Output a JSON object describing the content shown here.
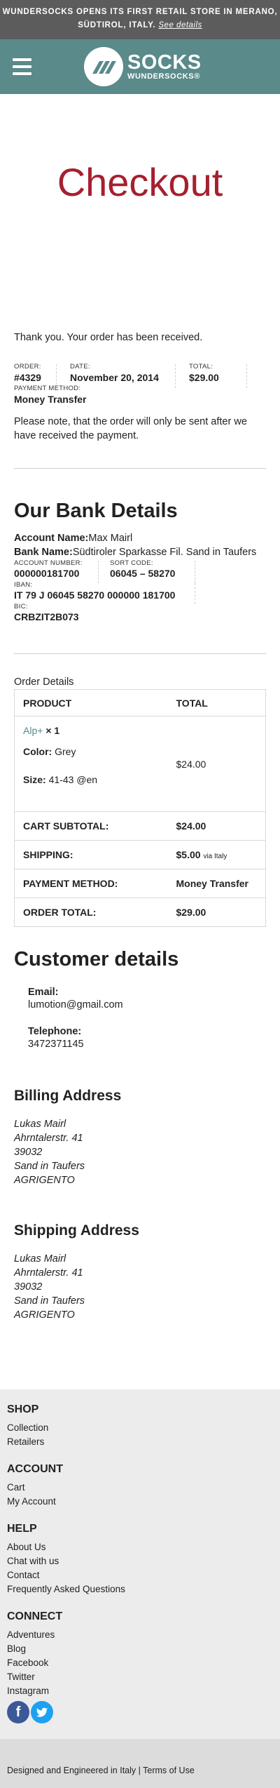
{
  "banner": {
    "text": "WUNDERSOCKS OPENS ITS FIRST RETAIL STORE IN MERANO, SÜDTIROL, ITALY.",
    "link": "See details"
  },
  "header": {
    "logo_big": "SOCKS",
    "logo_small": "WUNDERSOCKS®"
  },
  "page_title": "Checkout",
  "thanks": "Thank you. Your order has been received.",
  "order": {
    "order_label": "ORDER:",
    "order_value": "#4329",
    "date_label": "DATE:",
    "date_value": "November 20, 2014",
    "total_label": "TOTAL:",
    "total_value": "$29.00",
    "pm_label": "PAYMENT METHOD:",
    "pm_value": "Money Transfer"
  },
  "note": "Please note, that the order will only be sent after we have received the payment.",
  "bank": {
    "title": "Our Bank Details",
    "account_name_label": "Account Name:",
    "account_name": "Max Mairl",
    "bank_name_label": "Bank Name:",
    "bank_name": "Südtiroler Sparkasse Fil. Sand in Taufers",
    "account_number_label": "ACCOUNT NUMBER:",
    "account_number": "000000181700",
    "sort_code_label": "SORT CODE:",
    "sort_code": "06045 – 58270",
    "iban_label": "IBAN:",
    "iban": "IT 79 J 06045 58270 000000 181700",
    "bic_label": "BIC:",
    "bic": "CRBZIT2B073"
  },
  "order_details": {
    "title": "Order Details",
    "col_product": "PRODUCT",
    "col_total": "TOTAL",
    "product_name": "Alp+",
    "product_qty": "× 1",
    "color_label": "Color:",
    "color_value": "Grey",
    "size_label": "Size:",
    "size_value": "41-43 @en",
    "product_price": "$24.00",
    "subtotal_label": "CART SUBTOTAL:",
    "subtotal": "$24.00",
    "shipping_label": "SHIPPING:",
    "shipping": "$5.00",
    "shipping_via": "via Italy",
    "payment_label": "PAYMENT METHOD:",
    "payment": "Money Transfer",
    "total_label": "ORDER TOTAL:",
    "total": "$29.00"
  },
  "customer": {
    "title": "Customer details",
    "email_label": "Email:",
    "email": "lumotion@gmail.com",
    "tel_label": "Telephone:",
    "tel": "3472371145"
  },
  "billing": {
    "title": "Billing Address",
    "lines": [
      "Lukas Mairl",
      "Ahrntalerstr. 41",
      "39032",
      "Sand in Taufers",
      "AGRIGENTO"
    ]
  },
  "shipping_addr": {
    "title": "Shipping Address",
    "lines": [
      "Lukas Mairl",
      "Ahrntalerstr. 41",
      "39032",
      "Sand in Taufers",
      "AGRIGENTO"
    ]
  },
  "footer": {
    "shop": {
      "title": "SHOP",
      "links": [
        "Collection",
        "Retailers"
      ]
    },
    "account": {
      "title": "ACCOUNT",
      "links": [
        "Cart",
        "My Account"
      ]
    },
    "help": {
      "title": "HELP",
      "links": [
        "About Us",
        "Chat with us",
        "Contact",
        "Frequently Asked Questions"
      ]
    },
    "connect": {
      "title": "CONNECT",
      "links": [
        "Adventures",
        "Blog",
        "Facebook",
        "Twitter",
        "Instagram"
      ]
    },
    "social_icons": [
      "facebook-icon",
      "twitter-icon"
    ],
    "bottom_text": "Designed and Engineered in Italy",
    "bottom_sep": "|",
    "bottom_link": "Terms of Use"
  },
  "colors": {
    "accent": "#a5202f",
    "brand": "#5a8a8a",
    "banner": "#5c5c5c",
    "footer_bg": "#ececec"
  }
}
